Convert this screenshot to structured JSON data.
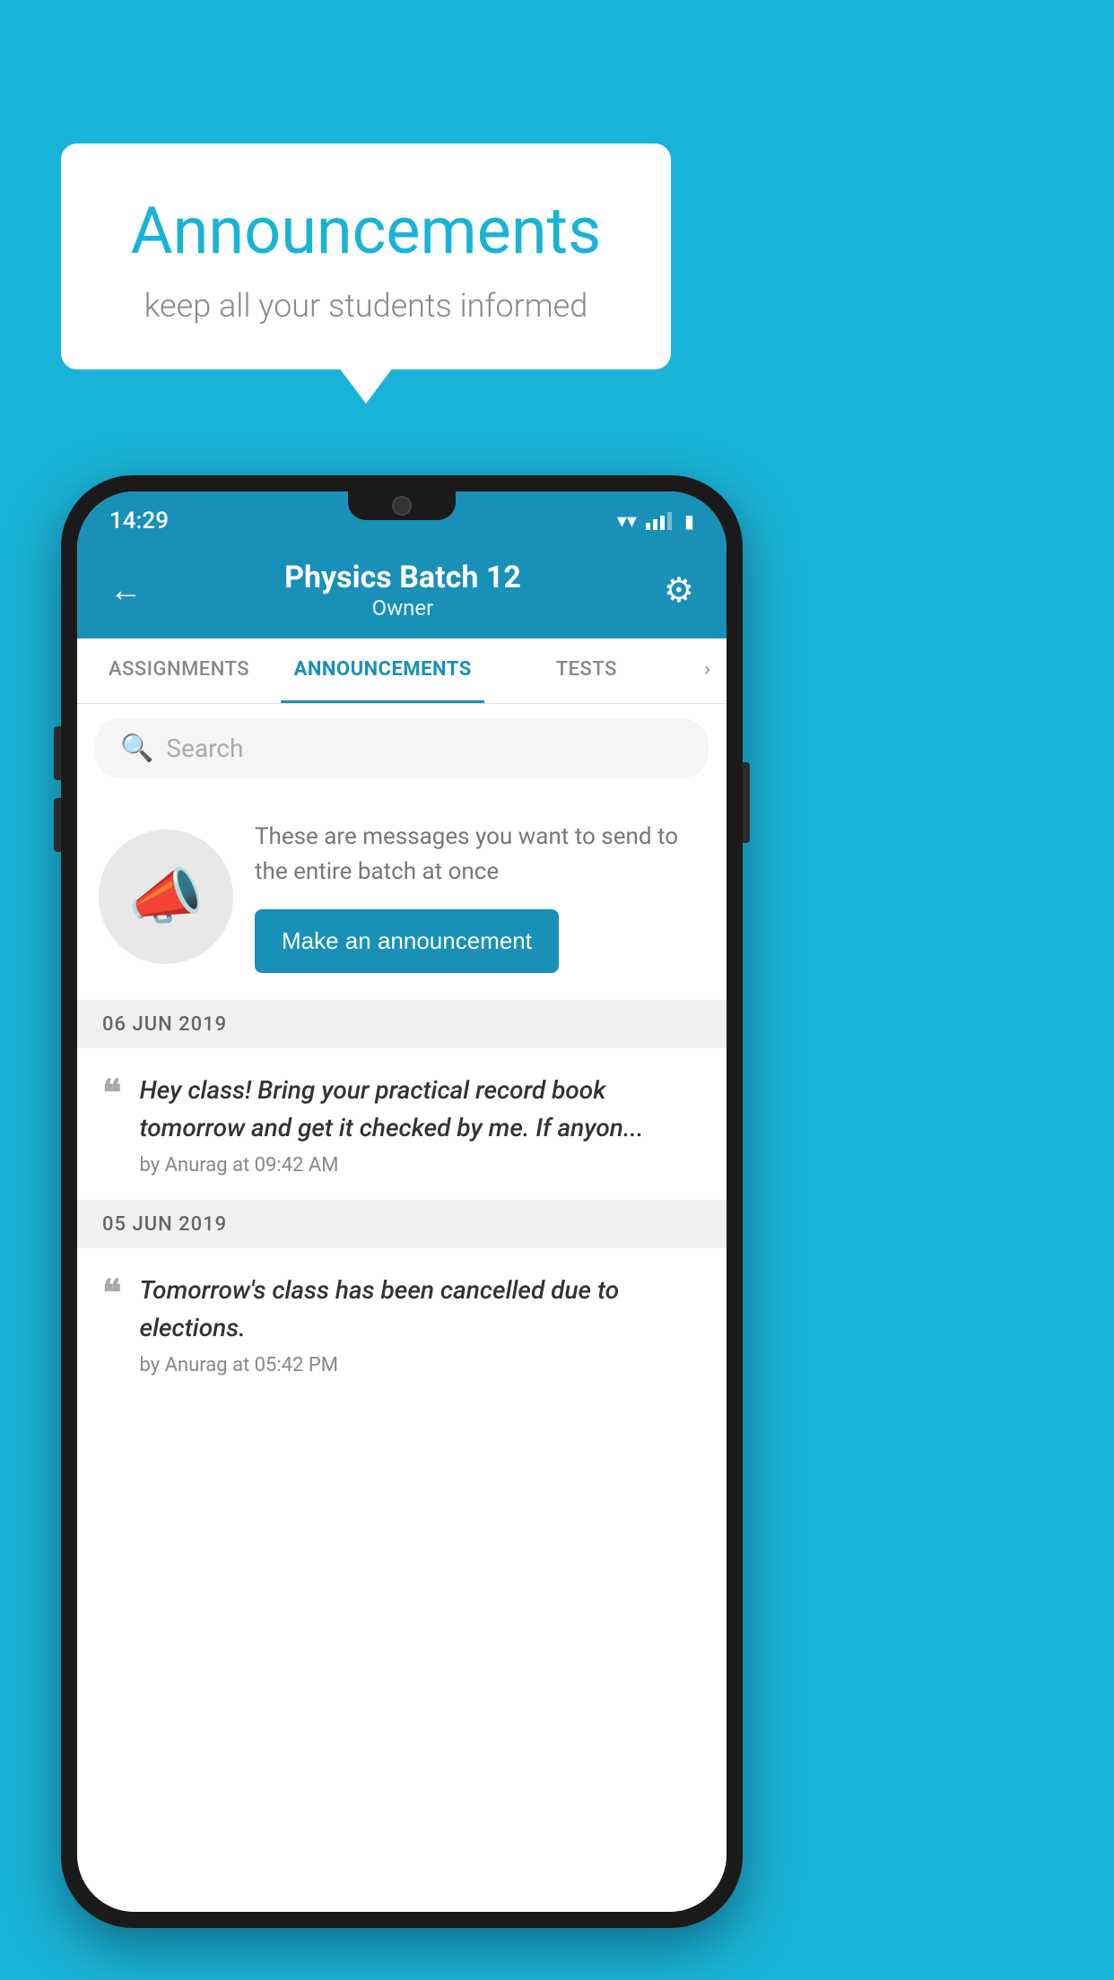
{
  "background": {
    "color": "#1ab3d8"
  },
  "speech_bubble": {
    "title": "Announcements",
    "subtitle": "keep all your students informed"
  },
  "phone": {
    "status_bar": {
      "time": "14:29"
    },
    "header": {
      "title": "Physics Batch 12",
      "subtitle": "Owner",
      "back_label": "←",
      "gear_label": "⚙"
    },
    "tabs": [
      {
        "label": "ASSIGNMENTS",
        "active": false
      },
      {
        "label": "ANNOUNCEMENTS",
        "active": true
      },
      {
        "label": "TESTS",
        "active": false
      }
    ],
    "search": {
      "placeholder": "Search"
    },
    "empty_state": {
      "description": "These are messages you want to send to the entire batch at once",
      "button_label": "Make an announcement"
    },
    "announcements": [
      {
        "date": "06  JUN  2019",
        "message": "Hey class! Bring your practical record book tomorrow and get it checked by me. If anyon...",
        "meta": "by Anurag at 09:42 AM"
      },
      {
        "date": "05  JUN  2019",
        "message": "Tomorrow's class has been cancelled due to elections.",
        "meta": "by Anurag at 05:42 PM"
      }
    ]
  }
}
